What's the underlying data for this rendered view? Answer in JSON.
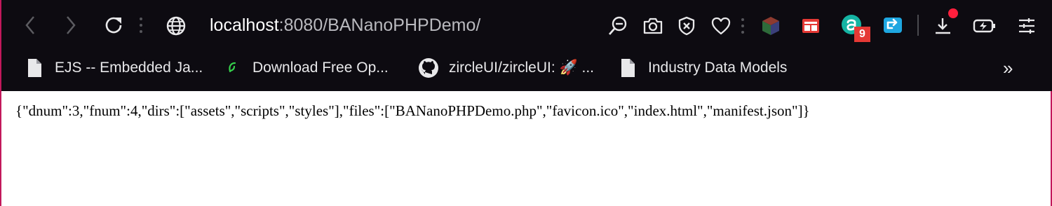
{
  "toolbar": {
    "url_host": "localhost",
    "url_path": ":8080/BANanoPHPDemo/",
    "extension_badge": "9"
  },
  "bookmarks": [
    {
      "label": "EJS -- Embedded Ja...",
      "icon": "document-icon"
    },
    {
      "label": "Download Free Op...",
      "icon": "leaf-favicon-icon"
    },
    {
      "label": "zircleUI/zircleUI: 🚀 ...",
      "icon": "github-icon"
    },
    {
      "label": "Industry Data Models",
      "icon": "document-icon"
    }
  ],
  "bookmarks_overflow": "»",
  "page": {
    "json_text": "{\"dnum\":3,\"fnum\":4,\"dirs\":[\"assets\",\"scripts\",\"styles\"],\"files\":[\"BANanoPHPDemo.php\",\"favicon.ico\",\"index.html\",\"manifest.json\"]}"
  },
  "colors": {
    "chrome_bg": "#0d0b11",
    "frame_accent": "#c2185b",
    "badge_red": "#e53935",
    "icon_color": "#e8e8ea"
  }
}
